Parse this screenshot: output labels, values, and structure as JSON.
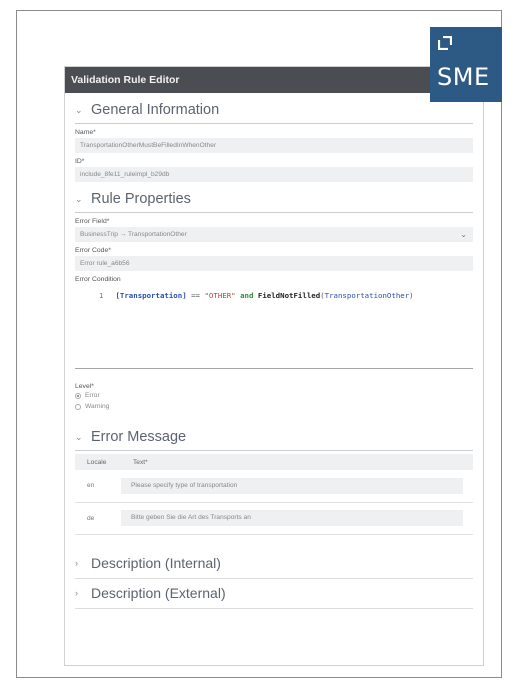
{
  "window": {
    "title": "Validation Rule Editor"
  },
  "logo": {
    "text": "SME"
  },
  "general": {
    "title": "General Information",
    "name_label": "Name*",
    "name_value": "TransportationOtherMustBeFilledInWhenOther",
    "id_label": "ID*",
    "id_value": "include_8fe11_ruleimpl_b29db"
  },
  "rule": {
    "title": "Rule Properties",
    "error_field_label": "Error Field*",
    "error_field_value": "BusinessTrip → TransportationOther",
    "error_code_label": "Error Code*",
    "error_code_value": "Error rule_a6b56",
    "condition_label": "Error Condition",
    "condition": {
      "line_number": "1",
      "open_bracket": "[",
      "field": "Transportation",
      "close_bracket": "]",
      "op": " == ",
      "string": "\"OTHER\"",
      "keyword": " and ",
      "func": "FieldNotFilled",
      "paren_open": "(",
      "arg": "TransportationOther",
      "paren_close": ")"
    }
  },
  "level": {
    "label": "Level*",
    "options": [
      {
        "label": "Error",
        "checked": true
      },
      {
        "label": "Warning",
        "checked": false
      }
    ]
  },
  "error_message": {
    "title": "Error Message",
    "columns": [
      "Locale",
      "Text*"
    ],
    "rows": [
      {
        "locale": "en",
        "text": "Please specify type of transportation"
      },
      {
        "locale": "de",
        "text": "Bitte geben Sie die Art des Transports an"
      }
    ]
  },
  "description_internal": {
    "title": "Description (Internal)"
  },
  "description_external": {
    "title": "Description (External)"
  },
  "icons": {
    "expanded": "chevron-down-icon",
    "collapsed": "chevron-right-icon",
    "select": "dropdown-caret-icon"
  }
}
